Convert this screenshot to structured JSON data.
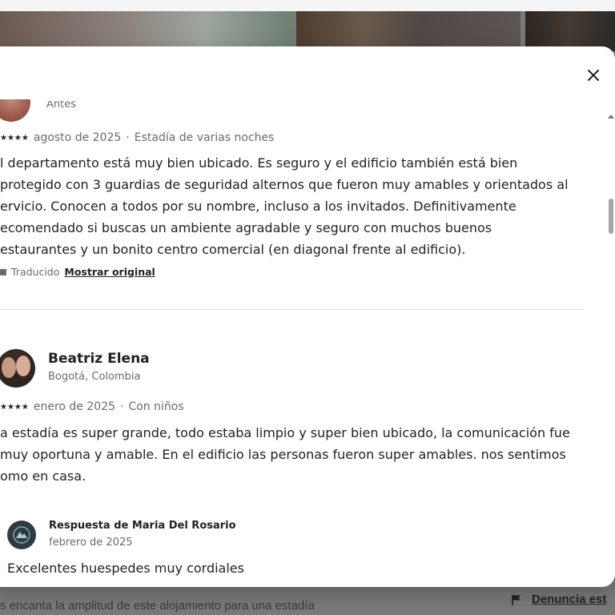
{
  "background": {
    "bottom_text": "s encanta la amplitud de este alojamiento para una estadía",
    "report_link": "Denuncia est"
  },
  "modal": {
    "close_icon": "close-icon",
    "reviews": [
      {
        "location": "Antes",
        "stars": "★★★★",
        "date": "agosto de 2025",
        "stay_type": "Estadía de varias noches",
        "body": "l departamento está muy bien ubicado. Es seguro y el edificio también está bien protegido con 3 guardias de seguridad alternos que fueron muy amables y orientados al ervicio. Conocen a todos por su nombre, incluso a los invitados. Definitivamente ecomendado si buscas un ambiente agradable y seguro con muchos buenos estaurantes y un bonito centro comercial (en diagonal frente al edificio).",
        "body_lines": [
          "l departamento está muy bien ubicado. Es seguro y el edificio también está bien",
          "protegido con 3 guardias de seguridad alternos que fueron muy amables y orientados al",
          "ervicio. Conocen a todos por su nombre, incluso a los invitados. Definitivamente",
          "ecomendado si buscas un ambiente agradable y seguro con muchos buenos",
          "estaurantes y un bonito centro comercial (en diagonal frente al edificio)."
        ],
        "translated_label": "Traducido",
        "show_original": "Mostrar original"
      },
      {
        "name": "Beatriz Elena",
        "location": "Bogotá, Colombia",
        "stars": "★★★★",
        "date": "enero de 2025",
        "stay_type": "Con niños",
        "body_lines": [
          "a estadía es super grande, todo estaba limpio y super bien ubicado, la comunicación fue",
          "muy oportuna y amable. En el edificio las personas fueron super amables. nos sentimos",
          "omo en casa."
        ],
        "response": {
          "title": "Respuesta de Maria Del Rosario",
          "date": "febrero de 2025",
          "text": "Excelentes huespedes muy cordiales"
        }
      }
    ]
  }
}
